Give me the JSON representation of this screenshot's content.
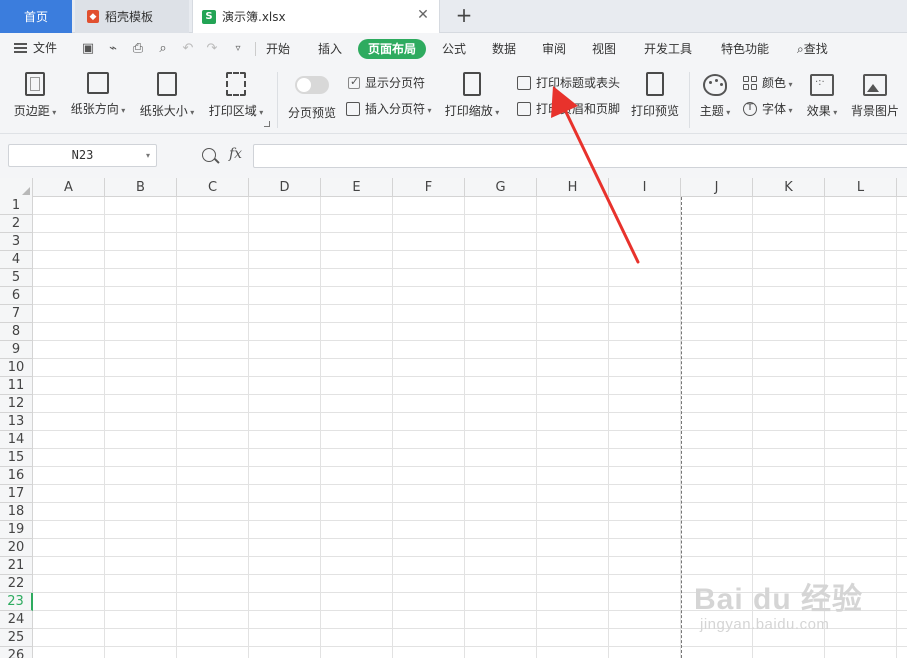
{
  "tabs": {
    "home": "首页",
    "shell": "稻壳模板",
    "doc": "演示簿.xlsx",
    "doc_icon": "S"
  },
  "menu": {
    "file": "文件",
    "items": [
      "开始",
      "插入",
      "页面布局",
      "公式",
      "数据",
      "审阅",
      "视图",
      "开发工具",
      "特色功能"
    ],
    "active_index": 2,
    "search": "查找"
  },
  "ribbon": {
    "margins": "页边距",
    "orientation": "纸张方向",
    "size": "纸张大小",
    "print_area": "打印区域",
    "page_break_preview": "分页预览",
    "show_page_breaks": "显示分页符",
    "insert_page_break": "插入分页符",
    "print_scaling": "打印缩放",
    "print_titles": "打印标题或表头",
    "print_header_footer": "打印页眉和页脚",
    "print_preview": "打印预览",
    "theme": "主题",
    "colors": "颜色",
    "fonts": "字体",
    "effects": "效果",
    "background": "背景图片"
  },
  "formula_bar": {
    "cell_ref": "N23",
    "fx": "fx",
    "value": ""
  },
  "sheet": {
    "columns": [
      "A",
      "B",
      "C",
      "D",
      "E",
      "F",
      "G",
      "H",
      "I",
      "J",
      "K",
      "L"
    ],
    "rows": [
      "1",
      "2",
      "3",
      "4",
      "5",
      "6",
      "7",
      "8",
      "9",
      "10",
      "11",
      "12",
      "13",
      "14",
      "15",
      "16",
      "17",
      "18",
      "19",
      "20",
      "21",
      "22",
      "23",
      "24",
      "25",
      "26"
    ],
    "selected_row": "23"
  },
  "colors": {
    "accent_green": "#2eab5f",
    "home_tab_blue": "#3b7ddd",
    "arrow_red": "#e8322c"
  },
  "watermark": {
    "main": "Bai du 经验",
    "sub": "jingyan.baidu.com"
  }
}
